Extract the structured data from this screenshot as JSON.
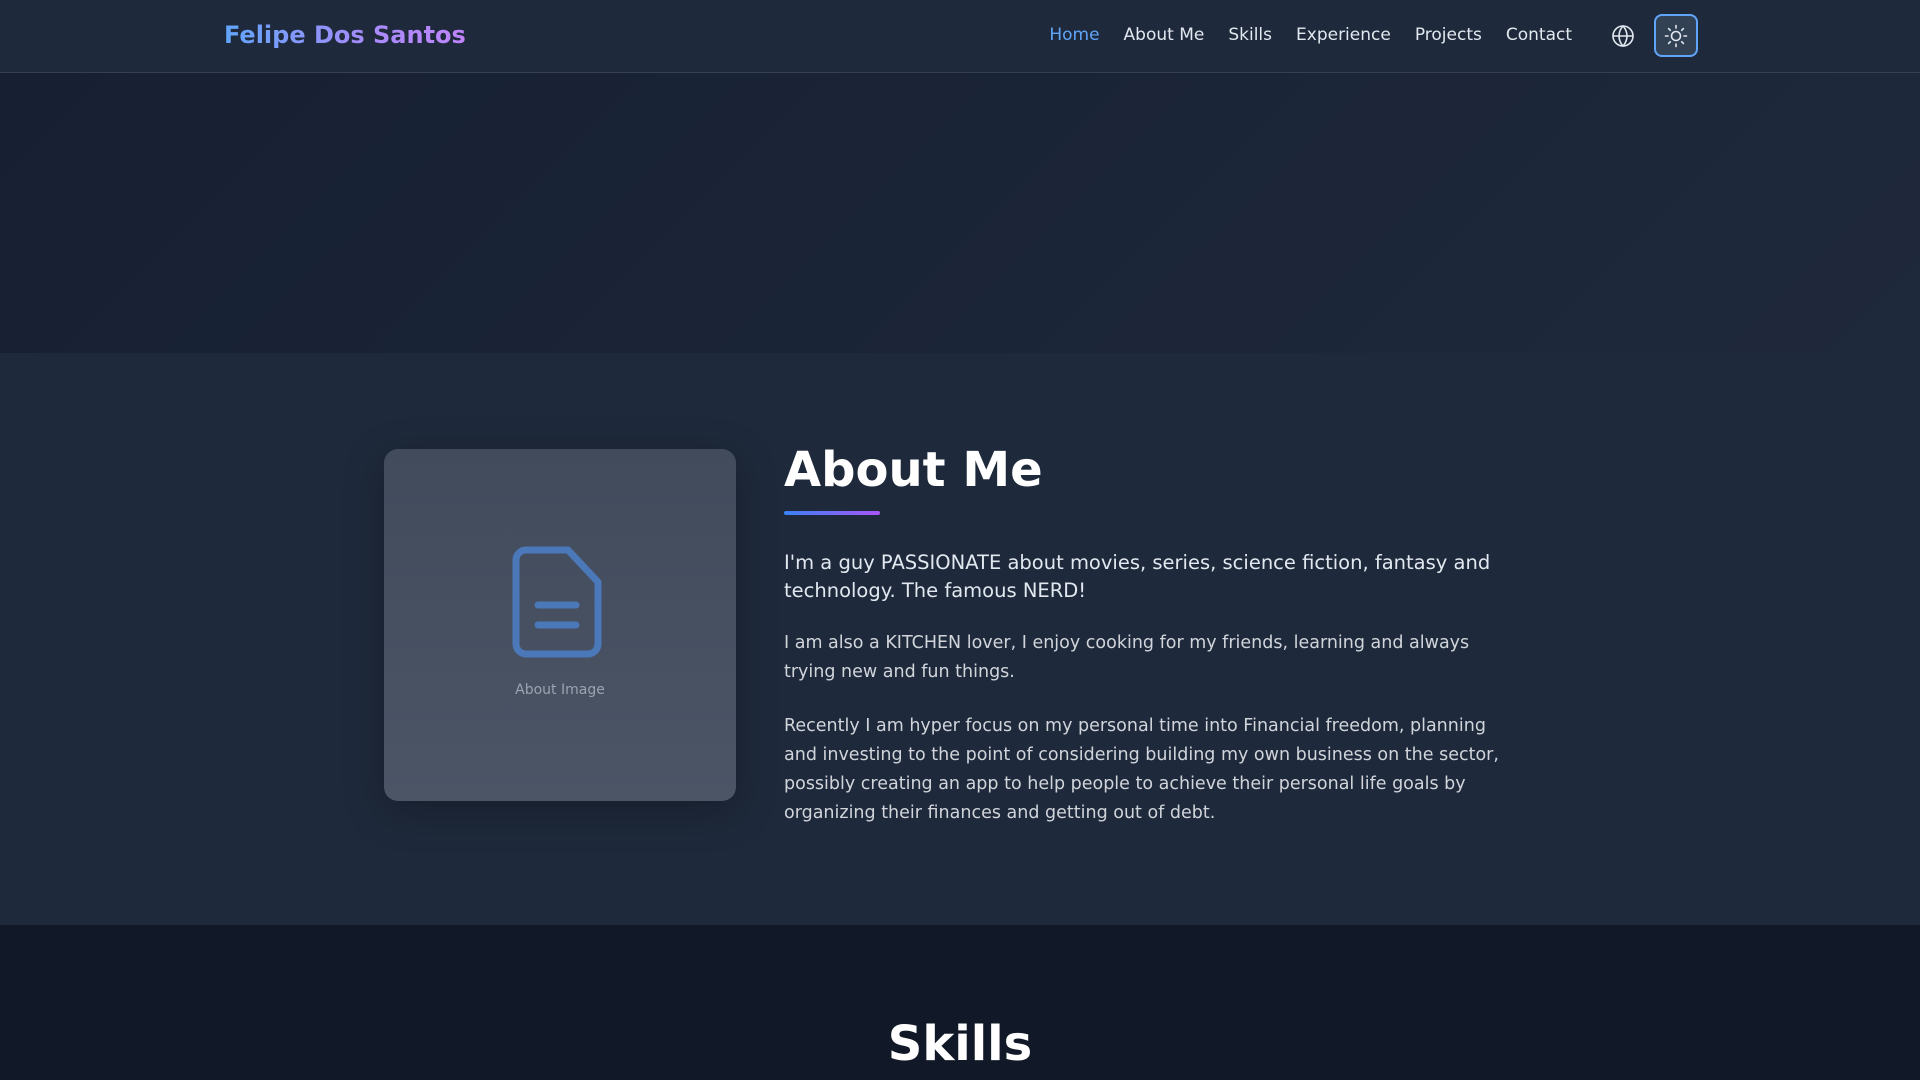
{
  "nav": {
    "brand": "Felipe Dos Santos",
    "links": [
      {
        "label": "Home",
        "active": true
      },
      {
        "label": "About Me",
        "active": false
      },
      {
        "label": "Skills",
        "active": false
      },
      {
        "label": "Experience",
        "active": false
      },
      {
        "label": "Projects",
        "active": false
      },
      {
        "label": "Contact",
        "active": false
      }
    ],
    "language_icon": "globe-icon",
    "theme_icon": "sun-icon"
  },
  "about": {
    "title": "About Me",
    "image_caption": "About Image",
    "image_icon": "document-icon",
    "lead": "I'm a guy PASSIONATE about movies, series, science fiction, fantasy and technology. The famous NERD!",
    "paragraphs": [
      "I am also a KITCHEN lover, I enjoy cooking for my friends, learning and always trying new and fun things.",
      "Recently I am hyper focus on my personal time into Financial freedom, planning and investing to the point of considering building my own business on the sector, possibly creating an app to help people to achieve their personal life goals by organizing their finances and getting out of debt."
    ]
  },
  "skills": {
    "title": "Skills"
  },
  "colors": {
    "accent": "#60a5fa",
    "accent_secondary": "#a855f7",
    "background": "#1e293b",
    "dark_section": "#111827"
  }
}
